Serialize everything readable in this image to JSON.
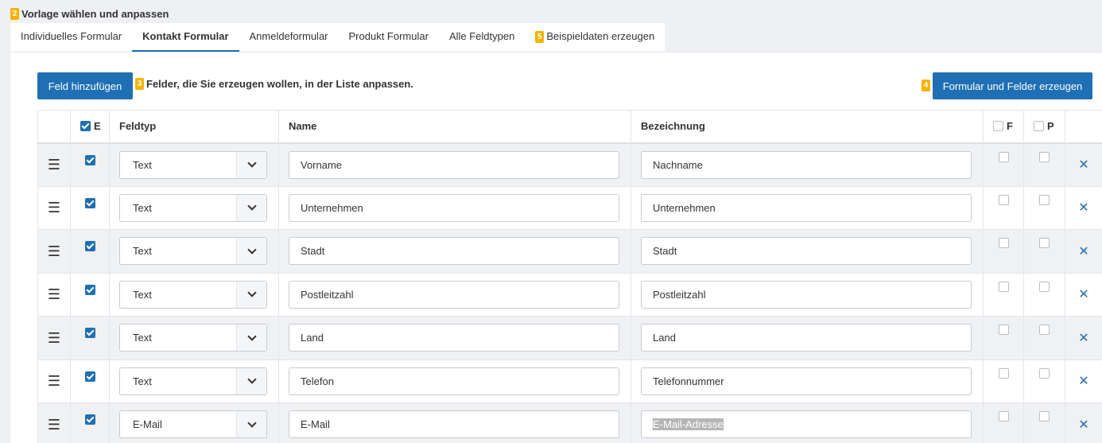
{
  "section": {
    "badge": "2",
    "title": "Vorlage wählen und anpassen"
  },
  "tabs": [
    {
      "label": "Individuelles Formular"
    },
    {
      "label": "Kontakt Formular"
    },
    {
      "label": "Anmeldeformular"
    },
    {
      "label": "Produkt Formular"
    },
    {
      "label": "Alle Feldtypen"
    },
    {
      "label": "Beispieldaten erzeugen",
      "badge": "5"
    }
  ],
  "toolbar": {
    "add_label": "Feld hinzufügen",
    "hint_badge": "3",
    "hint": "Felder, die Sie erzeugen wollen, in der Liste anpassen.",
    "create_badge": "4",
    "create_label": "Formular und Felder erzeugen"
  },
  "table": {
    "headers": {
      "e": "E",
      "type": "Feldtyp",
      "name": "Name",
      "label": "Bezeichnung",
      "f": "F",
      "p": "P"
    },
    "rows": [
      {
        "type": "Text",
        "name": "Vorname",
        "label": "Nachname"
      },
      {
        "type": "Text",
        "name": "Unternehmen",
        "label": "Unternehmen"
      },
      {
        "type": "Text",
        "name": "Stadt",
        "label": "Stadt"
      },
      {
        "type": "Text",
        "name": "Postleitzahl",
        "label": "Postleitzahl"
      },
      {
        "type": "Text",
        "name": "Land",
        "label": "Land"
      },
      {
        "type": "Text",
        "name": "Telefon",
        "label": "Telefonnummer"
      },
      {
        "type": "E-Mail",
        "name": "E-Mail",
        "label": "E-Mail-Adresse"
      }
    ]
  },
  "icons": {
    "drag": "hamburger-icon",
    "delete": "close-icon",
    "dropdown": "chevron-down-icon"
  },
  "colors": {
    "accent": "#1f6fb5",
    "badge": "#f5b400"
  }
}
